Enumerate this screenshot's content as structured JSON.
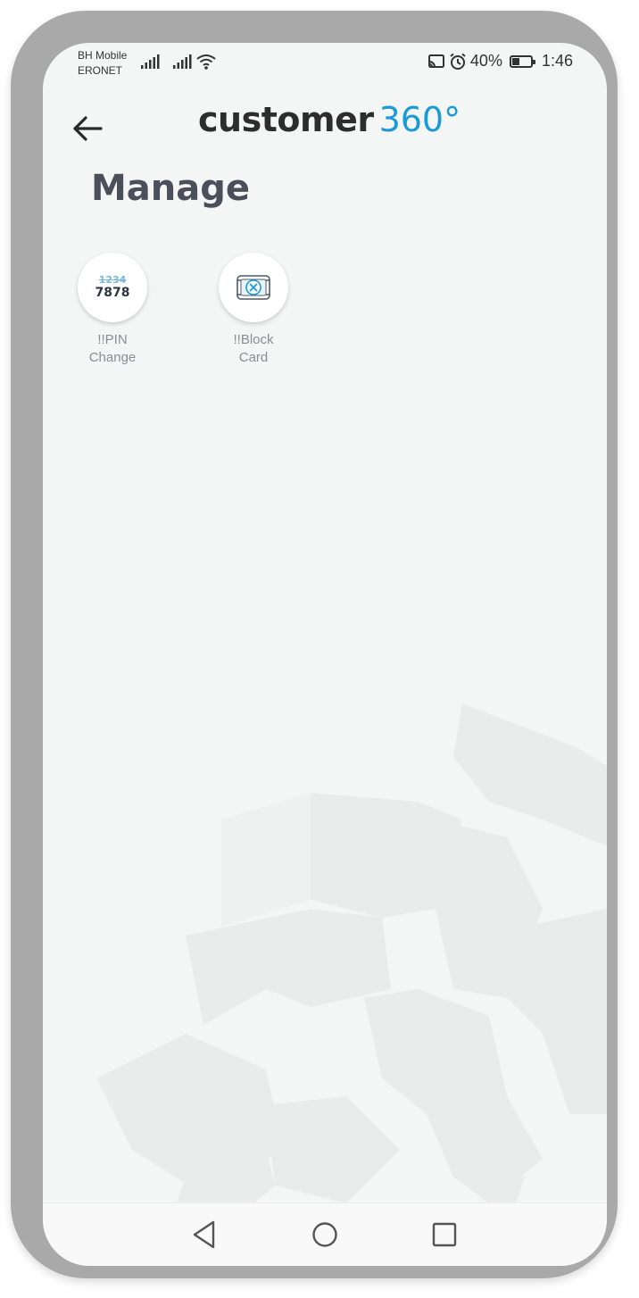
{
  "status_bar": {
    "carrier_line1": "BH Mobile",
    "carrier_line2": "ERONET",
    "battery_percent": "40%",
    "battery_level": 0.4,
    "time": "1:46"
  },
  "header": {
    "logo_main": "customer",
    "logo_accent": "360°"
  },
  "page": {
    "title": "Manage"
  },
  "actions": [
    {
      "label_line1": "!!PIN",
      "label_line2": "Change",
      "icon": "pin-change-icon",
      "icon_text_old": "1234",
      "icon_text_new": "7878"
    },
    {
      "label_line1": "!!Block",
      "label_line2": "Card",
      "icon": "block-card-icon"
    }
  ],
  "nav": {
    "back": "triangle-back-icon",
    "home": "circle-home-icon",
    "recents": "square-recents-icon"
  },
  "colors": {
    "accent": "#1a9ad6",
    "title": "#4a4f5a",
    "label": "#8a8d92",
    "background": "#f4f5f5"
  }
}
